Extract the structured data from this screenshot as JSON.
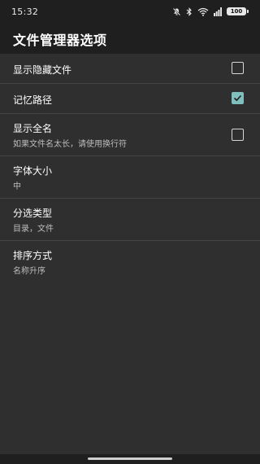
{
  "status": {
    "time": "15:32",
    "battery": "100",
    "icons": [
      "mute-icon",
      "bluetooth-icon",
      "wifi-icon",
      "signal-icon",
      "battery-icon"
    ]
  },
  "toolbar": {
    "title": "文件管理器选项"
  },
  "options": [
    {
      "title": "显示隐藏文件",
      "subtitle": "",
      "checkbox": true,
      "checked": false
    },
    {
      "title": "记忆路径",
      "subtitle": "",
      "checkbox": true,
      "checked": true
    },
    {
      "title": "显示全名",
      "subtitle": "如果文件名太长，请使用换行符",
      "checkbox": true,
      "checked": false
    },
    {
      "title": "字体大小",
      "subtitle": "中",
      "checkbox": false
    },
    {
      "title": "分选类型",
      "subtitle": "目录，文件",
      "checkbox": false
    },
    {
      "title": "排序方式",
      "subtitle": "名称升序",
      "checkbox": false
    }
  ],
  "colors": {
    "background": "#2f2f2f",
    "bars": "#1f1f1f",
    "accent": "#7fbfbd",
    "divider": "#444444"
  }
}
